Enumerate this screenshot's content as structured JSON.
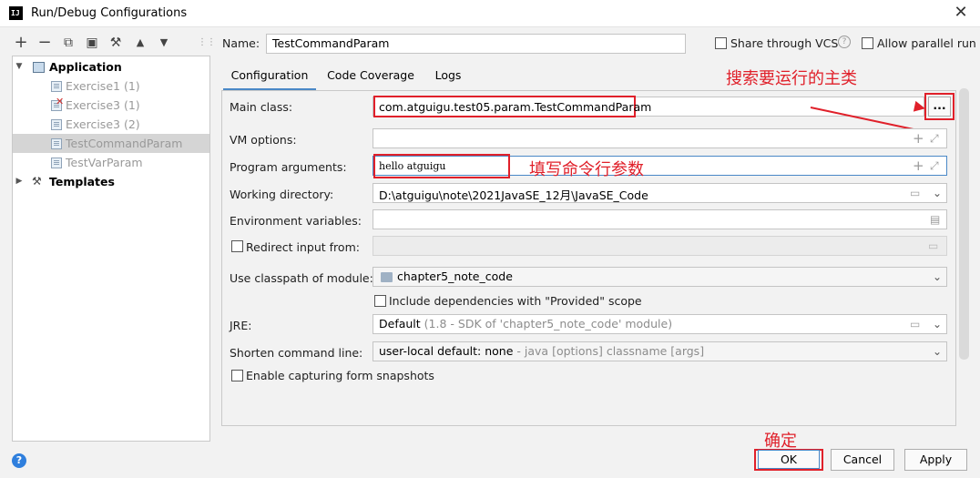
{
  "window": {
    "title": "Run/Debug Configurations",
    "app_icon_text": "IJ"
  },
  "toolbar": {
    "icons": [
      "add-icon",
      "remove-icon",
      "copy-icon",
      "save-icon",
      "wrench-icon",
      "move-up-icon",
      "move-down-icon",
      "collapse-icon"
    ],
    "glyphs": [
      "+",
      "−",
      "⧉",
      "▪",
      "🔧",
      "▲",
      "▼",
      "‹›"
    ]
  },
  "tree": {
    "application": "Application",
    "items": [
      {
        "label": "Exercise1 (1)",
        "error": false
      },
      {
        "label": "Exercise3 (1)",
        "error": true
      },
      {
        "label": "Exercise3 (2)",
        "error": false
      },
      {
        "label": "TestCommandParam",
        "error": false,
        "selected": true
      },
      {
        "label": "TestVarParam",
        "error": false
      }
    ],
    "templates": "Templates"
  },
  "header": {
    "name_label": "Name:",
    "name_value": "TestCommandParam",
    "share_label": "Share through VCS",
    "parallel_label": "Allow parallel run"
  },
  "tabs": [
    {
      "label": "Configuration",
      "active": true
    },
    {
      "label": "Code Coverage",
      "active": false
    },
    {
      "label": "Logs",
      "active": false
    }
  ],
  "form": {
    "main_class_label": "Main class:",
    "main_class_value": "com.atguigu.test05.param.TestCommandParam",
    "browse_label": "...",
    "vm_options_label": "VM options:",
    "program_args_label": "Program arguments:",
    "program_args_value": "hello atguigu",
    "working_dir_label": "Working directory:",
    "working_dir_value": "D:\\atguigu\\note\\2021JavaSE_12月\\JavaSE_Code",
    "env_label": "Environment variables:",
    "redirect_label": "Redirect input from:",
    "classpath_label": "Use classpath of module:",
    "classpath_value": "chapter5_note_code",
    "include_deps_label": "Include dependencies with \"Provided\" scope",
    "jre_label": "JRE:",
    "jre_value": "Default",
    "jre_hint": "(1.8 - SDK of 'chapter5_note_code' module)",
    "shorten_label": "Shorten command line:",
    "shorten_value": "user-local default: none",
    "shorten_hint": "- java [options] classname [args]",
    "snapshots_label": "Enable capturing form snapshots"
  },
  "annotations": {
    "search_main": "搜索要运行的主类",
    "fill_args": "填写命令行参数",
    "confirm": "确定"
  },
  "buttons": {
    "ok": "OK",
    "cancel": "Cancel",
    "apply": "Apply",
    "help": "?"
  },
  "colors": {
    "accent": "#4a88c7",
    "annotation_red": "#e0202a",
    "selection": "#d5d5d5"
  }
}
